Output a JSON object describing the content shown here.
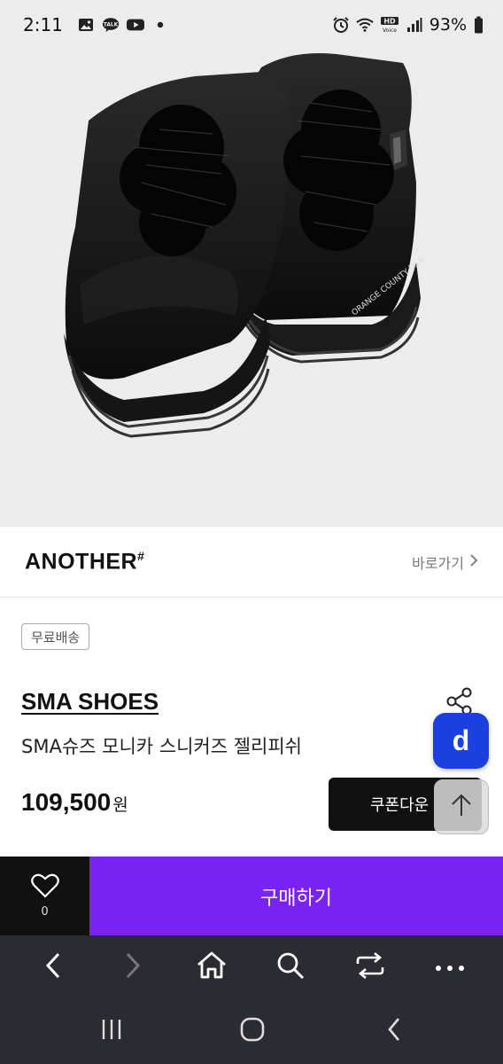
{
  "status_bar": {
    "time": "2:11",
    "notification_icons": [
      "gallery-icon",
      "talk-icon",
      "youtube-icon",
      "dot-icon"
    ],
    "talk_badge": "TALK",
    "hd_label": "HD",
    "voice_label": "Voice",
    "battery": "93%"
  },
  "brand": {
    "logo": "ANOTHER",
    "logo_mark": "#",
    "shortcut_label": "바로가기"
  },
  "product": {
    "badge": "무료배송",
    "brand_name": "SMA SHOES",
    "name": "SMA슈즈 모니카 스니커즈 젤리피쉬",
    "price": "109,500",
    "price_unit": "원",
    "image_text": "ORANGE COUNTY USA"
  },
  "actions": {
    "coupon_label": "쿠폰다운",
    "fab_label": "d",
    "buy_label": "구매하기",
    "like_count": "0"
  },
  "colors": {
    "buy": "#7b22f5",
    "fab": "#1c3fe0",
    "nav": "#2b2c33"
  }
}
